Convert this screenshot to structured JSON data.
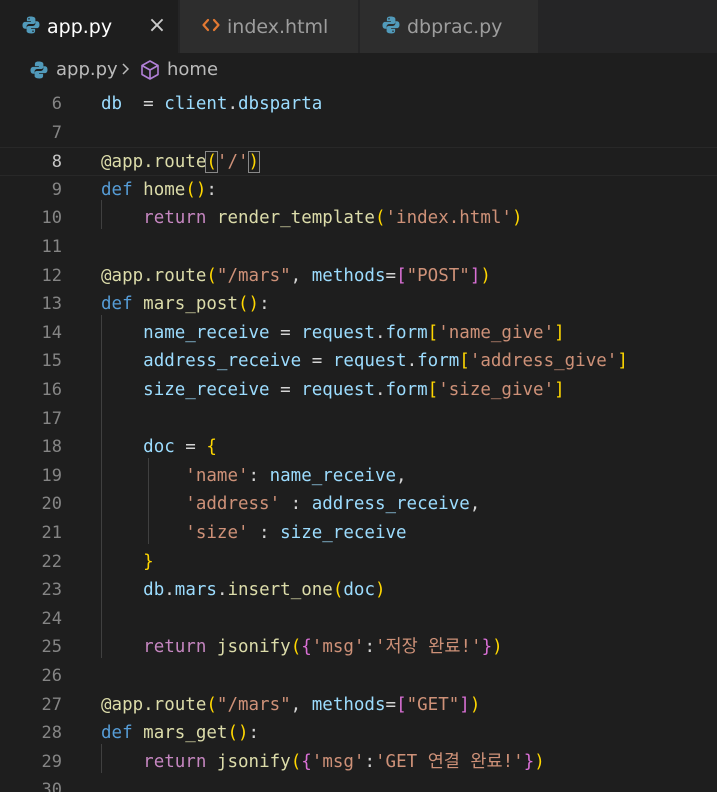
{
  "tabs": [
    {
      "label": "app.py",
      "icon": "python-icon",
      "active": true
    },
    {
      "label": "index.html",
      "icon": "html-icon",
      "active": false
    },
    {
      "label": "dbprac.py",
      "icon": "python-icon",
      "active": false
    }
  ],
  "close_glyph": "×",
  "breadcrumb": {
    "file": "app.py",
    "symbol": "home"
  },
  "colors": {
    "editor_bg": "#1e1e1e",
    "tab_inactive": "#2d2d2d",
    "keyword": "#569cd6",
    "control_keyword": "#c586c0",
    "function": "#dcdcaa",
    "variable": "#9cdcfe",
    "string": "#ce9178",
    "bracket_level1": "#ffd700",
    "bracket_level2": "#da70d6",
    "bracket_level3": "#179fff"
  },
  "code": {
    "current_line": 8,
    "lines": [
      {
        "n": "6",
        "tokens": [
          [
            "var",
            "db"
          ],
          [
            "",
            "  = "
          ],
          [
            "var",
            "client"
          ],
          [
            "",
            "."
          ],
          [
            "var",
            "dbsparta"
          ]
        ]
      },
      {
        "n": "7",
        "tokens": []
      },
      {
        "n": "8",
        "tokens": [
          [
            "dec",
            "@app.route"
          ],
          [
            "b1 brmatch",
            "("
          ],
          [
            "str",
            "'/'"
          ],
          [
            "b1 brmatch",
            ")"
          ]
        ]
      },
      {
        "n": "9",
        "tokens": [
          [
            "kw",
            "def"
          ],
          [
            "",
            " "
          ],
          [
            "fn",
            "home"
          ],
          [
            "b1",
            "()"
          ],
          [
            "",
            ":"
          ]
        ]
      },
      {
        "n": "10",
        "tokens": [
          [
            "",
            "    "
          ],
          [
            "ctl",
            "return"
          ],
          [
            "",
            " "
          ],
          [
            "fn",
            "render_template"
          ],
          [
            "b1",
            "("
          ],
          [
            "str",
            "'index.html'"
          ],
          [
            "b1",
            ")"
          ]
        ]
      },
      {
        "n": "11",
        "tokens": []
      },
      {
        "n": "12",
        "tokens": [
          [
            "dec",
            "@app.route"
          ],
          [
            "b1",
            "("
          ],
          [
            "str",
            "\"/mars\""
          ],
          [
            "",
            ", "
          ],
          [
            "var",
            "methods"
          ],
          [
            "",
            "="
          ],
          [
            "b2",
            "["
          ],
          [
            "str",
            "\"POST\""
          ],
          [
            "b2",
            "]"
          ],
          [
            "b1",
            ")"
          ]
        ]
      },
      {
        "n": "13",
        "tokens": [
          [
            "kw",
            "def"
          ],
          [
            "",
            " "
          ],
          [
            "fn",
            "mars_post"
          ],
          [
            "b1",
            "()"
          ],
          [
            "",
            ":"
          ]
        ]
      },
      {
        "n": "14",
        "tokens": [
          [
            "",
            "    "
          ],
          [
            "var",
            "name_receive"
          ],
          [
            "",
            " = "
          ],
          [
            "var",
            "request"
          ],
          [
            "",
            "."
          ],
          [
            "var",
            "form"
          ],
          [
            "b1",
            "["
          ],
          [
            "str",
            "'name_give'"
          ],
          [
            "b1",
            "]"
          ]
        ]
      },
      {
        "n": "15",
        "tokens": [
          [
            "",
            "    "
          ],
          [
            "var",
            "address_receive"
          ],
          [
            "",
            " = "
          ],
          [
            "var",
            "request"
          ],
          [
            "",
            "."
          ],
          [
            "var",
            "form"
          ],
          [
            "b1",
            "["
          ],
          [
            "str",
            "'address_give'"
          ],
          [
            "b1",
            "]"
          ]
        ]
      },
      {
        "n": "16",
        "tokens": [
          [
            "",
            "    "
          ],
          [
            "var",
            "size_receive"
          ],
          [
            "",
            " = "
          ],
          [
            "var",
            "request"
          ],
          [
            "",
            "."
          ],
          [
            "var",
            "form"
          ],
          [
            "b1",
            "["
          ],
          [
            "str",
            "'size_give'"
          ],
          [
            "b1",
            "]"
          ]
        ]
      },
      {
        "n": "17",
        "tokens": []
      },
      {
        "n": "18",
        "tokens": [
          [
            "",
            "    "
          ],
          [
            "var",
            "doc"
          ],
          [
            "",
            " = "
          ],
          [
            "b1",
            "{"
          ]
        ]
      },
      {
        "n": "19",
        "tokens": [
          [
            "",
            "        "
          ],
          [
            "str",
            "'name'"
          ],
          [
            "",
            ": "
          ],
          [
            "var",
            "name_receive"
          ],
          [
            "",
            ","
          ]
        ]
      },
      {
        "n": "20",
        "tokens": [
          [
            "",
            "        "
          ],
          [
            "str",
            "'address'"
          ],
          [
            "",
            " : "
          ],
          [
            "var",
            "address_receive"
          ],
          [
            "",
            ","
          ]
        ]
      },
      {
        "n": "21",
        "tokens": [
          [
            "",
            "        "
          ],
          [
            "str",
            "'size'"
          ],
          [
            "",
            " : "
          ],
          [
            "var",
            "size_receive"
          ]
        ]
      },
      {
        "n": "22",
        "tokens": [
          [
            "",
            "    "
          ],
          [
            "b1",
            "}"
          ]
        ]
      },
      {
        "n": "23",
        "tokens": [
          [
            "",
            "    "
          ],
          [
            "var",
            "db"
          ],
          [
            "",
            "."
          ],
          [
            "var",
            "mars"
          ],
          [
            "",
            "."
          ],
          [
            "fn",
            "insert_one"
          ],
          [
            "b1",
            "("
          ],
          [
            "var",
            "doc"
          ],
          [
            "b1",
            ")"
          ]
        ]
      },
      {
        "n": "24",
        "tokens": []
      },
      {
        "n": "25",
        "tokens": [
          [
            "",
            "    "
          ],
          [
            "ctl",
            "return"
          ],
          [
            "",
            " "
          ],
          [
            "fn",
            "jsonify"
          ],
          [
            "b1",
            "("
          ],
          [
            "b2",
            "{"
          ],
          [
            "str",
            "'msg'"
          ],
          [
            "",
            ":"
          ],
          [
            "str",
            "'저장 완료!'"
          ],
          [
            "b2",
            "}"
          ],
          [
            "b1",
            ")"
          ]
        ]
      },
      {
        "n": "26",
        "tokens": []
      },
      {
        "n": "27",
        "tokens": [
          [
            "dec",
            "@app.route"
          ],
          [
            "b1",
            "("
          ],
          [
            "str",
            "\"/mars\""
          ],
          [
            "",
            ", "
          ],
          [
            "var",
            "methods"
          ],
          [
            "",
            "="
          ],
          [
            "b2",
            "["
          ],
          [
            "str",
            "\"GET\""
          ],
          [
            "b2",
            "]"
          ],
          [
            "b1",
            ")"
          ]
        ]
      },
      {
        "n": "28",
        "tokens": [
          [
            "kw",
            "def"
          ],
          [
            "",
            " "
          ],
          [
            "fn",
            "mars_get"
          ],
          [
            "b1",
            "()"
          ],
          [
            "",
            ":"
          ]
        ]
      },
      {
        "n": "29",
        "tokens": [
          [
            "",
            "    "
          ],
          [
            "ctl",
            "return"
          ],
          [
            "",
            " "
          ],
          [
            "fn",
            "jsonify"
          ],
          [
            "b1",
            "("
          ],
          [
            "b2",
            "{"
          ],
          [
            "str",
            "'msg'"
          ],
          [
            "",
            ":"
          ],
          [
            "str",
            "'GET 연결 완료!'"
          ],
          [
            "b2",
            "}"
          ],
          [
            "b1",
            ")"
          ]
        ]
      },
      {
        "n": "30",
        "tokens": []
      }
    ]
  }
}
